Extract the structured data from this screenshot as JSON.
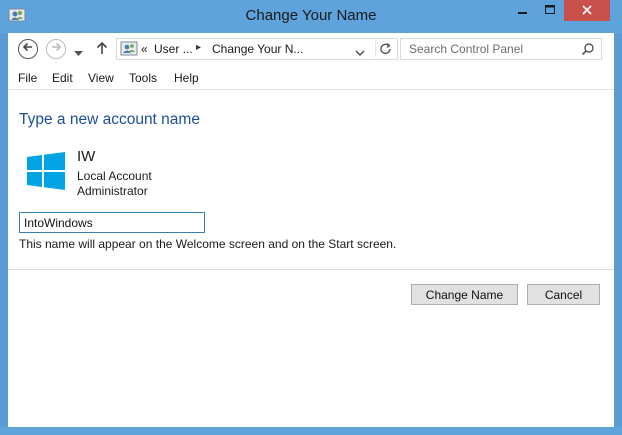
{
  "window": {
    "title": "Change Your Name"
  },
  "titlebar_icons": {
    "app": "user-accounts-icon",
    "minimize": "minimize-icon",
    "maximize": "maximize-icon",
    "close": "close-icon"
  },
  "address_bar": {
    "overflow": "«",
    "crumbs": [
      "User ...",
      "Change Your N..."
    ],
    "icons": [
      "back-icon",
      "forward-icon",
      "recent-dropdown-icon",
      "up-icon",
      "user-accounts-icon",
      "dropdown-icon",
      "refresh-icon"
    ]
  },
  "search": {
    "placeholder": "Search Control Panel"
  },
  "menu": [
    "File",
    "Edit",
    "View",
    "Tools",
    "Help"
  ],
  "content": {
    "heading": "Type a new account name",
    "account": {
      "name": "IW",
      "type": "Local Account",
      "role": "Administrator"
    },
    "new_name_value": "IntoWindows",
    "hint": "This name will appear on the Welcome screen and on the Start screen."
  },
  "buttons": {
    "change": "Change Name",
    "cancel": "Cancel"
  },
  "colors": {
    "frame": "#5ea3dc",
    "close_button": "#c7504b",
    "heading": "#1e4e9a",
    "windows_logo": "#00a4e4"
  }
}
